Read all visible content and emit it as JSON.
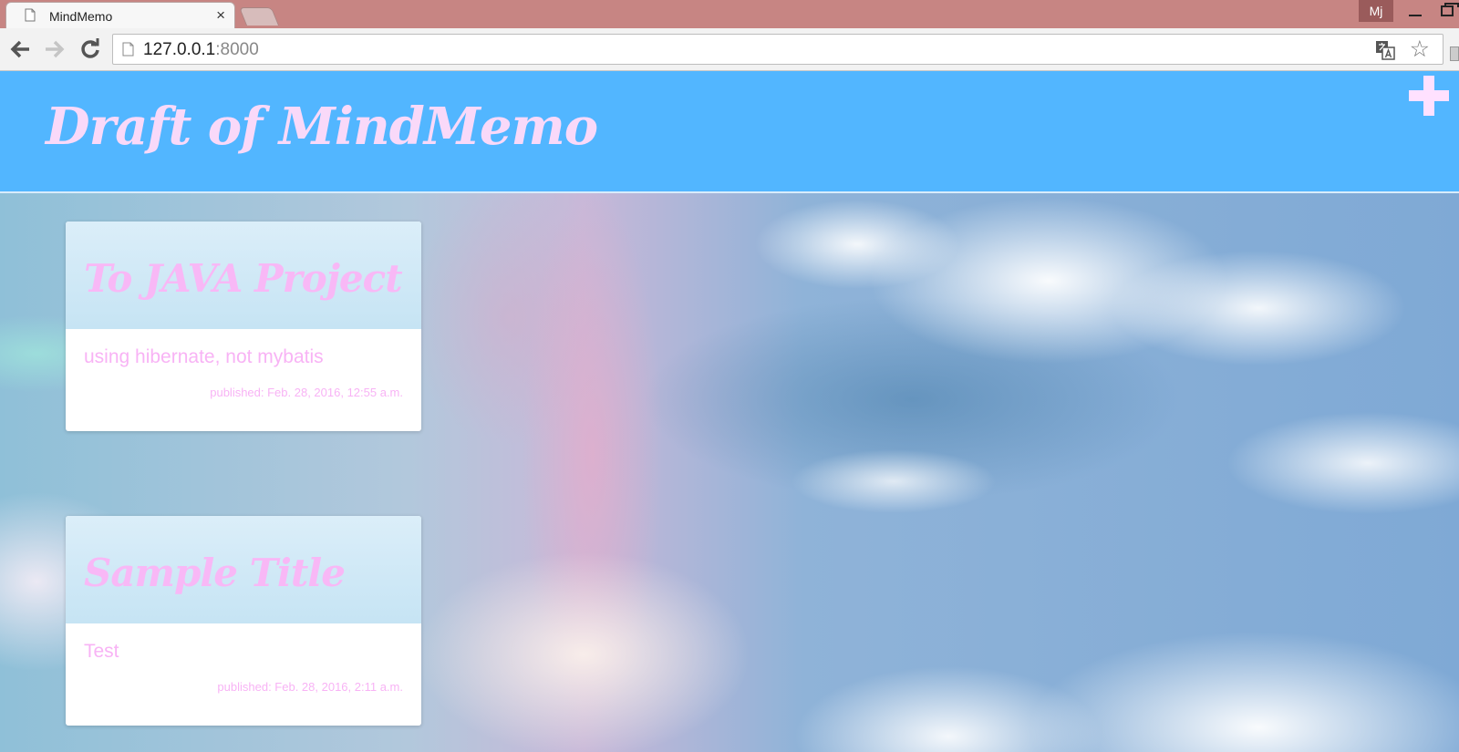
{
  "browser": {
    "tab_title": "MindMemo",
    "tab_close": "×",
    "profile": "Mj",
    "url_host": "127.0.0.1",
    "url_port": ":8000",
    "bookmark_star": "☆"
  },
  "header": {
    "title": "Draft of MindMemo"
  },
  "memos": [
    {
      "title": "To JAVA Project",
      "body": "using hibernate, not mybatis",
      "published": "published: Feb. 28, 2016, 12:55 a.m."
    },
    {
      "title": "Sample Title",
      "body": "Test",
      "published": "published: Feb. 28, 2016, 2:11 a.m."
    }
  ],
  "colors": {
    "header_bg": "#52b6ff",
    "title_text": "#f9d9f9",
    "memo_text": "#f8b3f5",
    "card_header_bg": "#d2eaf7"
  }
}
